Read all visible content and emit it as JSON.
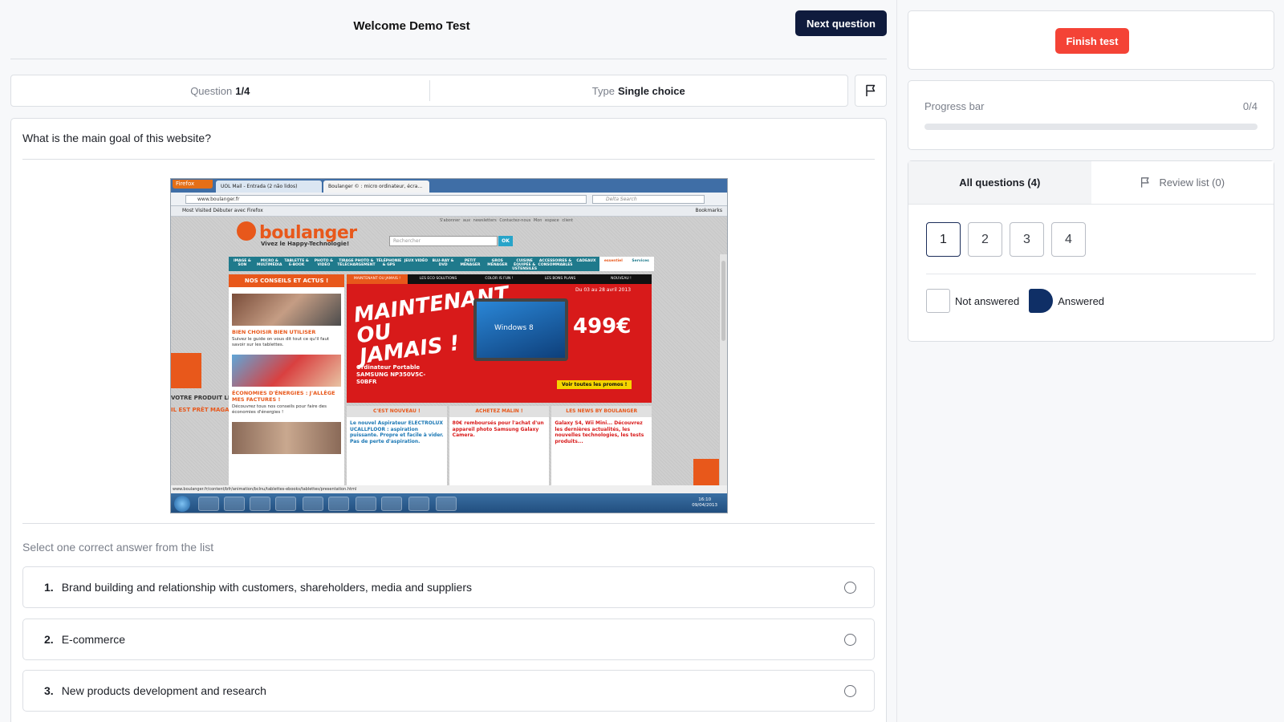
{
  "header": {
    "title": "Welcome Demo Test",
    "next_label": "Next question"
  },
  "meta": {
    "question_label": "Question",
    "question_value": "1/4",
    "type_label": "Type",
    "type_value": "Single choice"
  },
  "question": {
    "text": "What is the main goal of this website?",
    "instruction": "Select one correct answer from the list",
    "answers": [
      {
        "num": "1.",
        "text": "Brand building and relationship with customers, shareholders, media and suppliers"
      },
      {
        "num": "2.",
        "text": "E-commerce"
      },
      {
        "num": "3.",
        "text": "New products development and research"
      }
    ]
  },
  "screenshot": {
    "firefox_label": "Firefox",
    "tab1": "UOL Mail - Entrada (2 não lidos)",
    "tab2": "Boulanger © : micro ordinateur, écra...",
    "url": "www.boulanger.fr",
    "search_placeholder": "Delta Search",
    "bookmarks_left": "Most Visited   Débuter avec Firefox",
    "bookmarks_right": "Bookmarks",
    "logo": "boulanger",
    "tagline": "Vivez le Happy-Technologie!",
    "search_box": "Rechercher",
    "ok": "OK",
    "top_links": "S'abonner aux newsletters   Contactez-nous   Mon espace client",
    "menu": [
      "IMAGE & SON",
      "MICRO & MULTIMÉDIA",
      "TABLETTE & E-BOOK",
      "PHOTO & VIDÉO",
      "TIRAGE PHOTO & TÉLÉCHARGEMENT",
      "TÉLÉPHONIE & GPS",
      "JEUX VIDÉO",
      "BLU-RAY & DVD",
      "PETIT MÉNAGER",
      "GROS MÉNAGER",
      "CUISINE ÉQUIPÉE & USTENSILES",
      "ACCESSOIRES & CONSOMMABLES",
      "CADEAUX",
      "essentiel",
      "Services"
    ],
    "sidebar_head": "NOS CONSEILS ET ACTUS !",
    "sidebar_title1": "BIEN CHOISIR BIEN UTILISER",
    "sidebar_text1": "Suivez le guide on vous dit tout ce qu'il faut savoir sur les tablettes.",
    "sidebar_title2": "ÉCONOMIES D'ÉNERGIES : J'ALLÈGE MES FACTURES !",
    "sidebar_text2": "Découvrez tous nos conseils pour faire des économies d'énergies !",
    "hero_tabs": [
      "MAINTENANT OU JAMAIS !",
      "LES ECO SOLUTIONS",
      "COLOR IS FUN !",
      "LES BONS PLANS",
      "NOUVEAU !"
    ],
    "hero_title": "MAINTENANT OU JAMAIS !",
    "hero_date": "Du 03 au 28 avril 2013",
    "hero_price": "499€",
    "laptop_label": "Windows 8",
    "hero_sub": "Ordinateur Portable SAMSUNG NP350V5C-S0BFR",
    "promo": "Voir toutes les promos !",
    "cols": [
      {
        "head": "C'EST NOUVEAU !",
        "text": "Le nouvel Aspirateur ELECTROLUX UCALLFLOOR : aspiration puissante. Propre et facile à vider. Pas de perte d'aspiration."
      },
      {
        "head": "ACHETEZ MALIN !",
        "text": "80€ remboursés pour l'achat d'un appareil photo Samsung Galaxy Camera."
      },
      {
        "head": "LES NEWS BY BOULANGER",
        "text": "Galaxy S4, Wii Mini... Découvrez les dernières actualités, les nouvelles technologies, les tests produits..."
      }
    ],
    "side_text_a": "VOTRE PRODUIT LIGNE ...",
    "side_text_b": "IL EST PRÊT MAGASIN !",
    "status_url": "www.boulanger.fr/content/bfr/animation/bclnu/tablettes-ebooks/tablettes/presentation.html",
    "clock_time": "16:10",
    "clock_date": "09/04/2013"
  },
  "sidebar": {
    "finish_label": "Finish test",
    "progress_label": "Progress bar",
    "progress_count": "0/4",
    "progress_fraction": 0,
    "tab_all": "All questions (4)",
    "tab_review": "Review list (0)",
    "questions": [
      "1",
      "2",
      "3",
      "4"
    ],
    "legend_not_answered": "Not answered",
    "legend_answered": "Answered"
  },
  "colors": {
    "primary": "#0f1b3d",
    "danger": "#f44336",
    "answered": "#0f2f66"
  },
  "icons": {
    "flag": "flag-icon",
    "radio": "radio-icon"
  }
}
